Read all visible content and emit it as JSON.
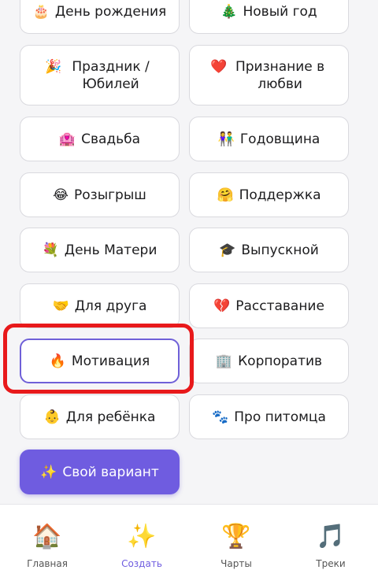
{
  "occasions": [
    {
      "emoji": "🎂",
      "label": "День рождения"
    },
    {
      "emoji": "🎄",
      "label": "Новый год"
    },
    {
      "emoji": "🎉",
      "label": "Праздник / Юбилей"
    },
    {
      "emoji": "❤️",
      "label": "Признание в любви"
    },
    {
      "emoji": "🏩",
      "label": "Свадьба"
    },
    {
      "emoji": "👫",
      "label": "Годовщина"
    },
    {
      "emoji": "😂",
      "label": "Розыгрыш"
    },
    {
      "emoji": "🤗",
      "label": "Поддержка"
    },
    {
      "emoji": "💐",
      "label": "День Матери"
    },
    {
      "emoji": "🎓",
      "label": "Выпускной"
    },
    {
      "emoji": "🤝",
      "label": "Для друга"
    },
    {
      "emoji": "💔",
      "label": "Расставание"
    },
    {
      "emoji": "🔥",
      "label": "Мотивация"
    },
    {
      "emoji": "🏢",
      "label": "Корпоратив"
    },
    {
      "emoji": "👶",
      "label": "Для ребёнка"
    },
    {
      "emoji": "🐾",
      "label": "Про питомца"
    }
  ],
  "selected_index": 12,
  "custom": {
    "emoji": "✨",
    "label": "Свой вариант"
  },
  "nav": [
    {
      "icon": "home-icon",
      "emoji": "🏠",
      "label": "Главная",
      "active": false
    },
    {
      "icon": "sparkles-icon",
      "emoji": "✨",
      "label": "Создать",
      "active": true
    },
    {
      "icon": "trophy-icon",
      "emoji": "🏆",
      "label": "Чарты",
      "active": false
    },
    {
      "icon": "music-note-icon",
      "emoji": "🎵",
      "label": "Треки",
      "active": false
    }
  ],
  "colors": {
    "accent": "#6f5ce0",
    "highlight": "#e8191b"
  }
}
